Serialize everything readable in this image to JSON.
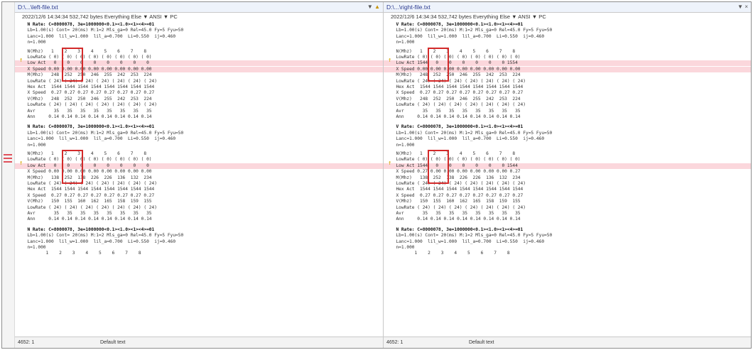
{
  "left": {
    "path": "D:\\...\\left-file.txt",
    "info": "2022/12/6 14:34:34  532,742 bytes  Everything Else ▼  ANSI ▼  PC",
    "status_pos": "4652: 1",
    "status_enc": "Default text"
  },
  "right": {
    "path": "D:\\...\\right-file.txt",
    "info": "2022/12/6 14:34:34  532,742 bytes  Everything Else ▼  ANSI ▼  PC",
    "status_pos": "4652: 1",
    "status_enc": "Default text"
  },
  "toolbar": {
    "nav_up": "▲",
    "nav_dn": "▼",
    "close": "×"
  },
  "block1": {
    "header_l": "  N Rate: C=8000078, 3e=1000000<0.1><1.0><1><4>=01",
    "header_r": "  V Rate: C=8000078, 3e=1000000<0.1><1.0><1><4>=01",
    "rows": [
      {
        "h": false,
        "l": "  N(Mhz)   1    2    3    4    5    6    7    8",
        "r": "  N(Mhz)   1    2    3    4    5    6    7    8"
      },
      {
        "h": false,
        "l": "  LowRate ( 0) ( 0) ( 0) ( 0) ( 0) ( 0) ( 0) ( 0)",
        "r": "  LowRate ( 0) ( 0) ( 0) ( 0) ( 0) ( 0) ( 0) ( 0)"
      },
      {
        "h": true,
        "l": "  Low Act   0    0    0    0    0    0    0    0",
        "r": "  Low Act 1544   0    0    0    0    0    0 1554"
      },
      {
        "h": true,
        "l": "  X Speed 0.00 0.00 0.00 0.00 0.00 0.00 0.00 0.00",
        "r": "  X Speed 0.00 0.00 0.00 0.00 0.00 0.00 0.00 0.00"
      },
      {
        "h": false,
        "l": "  M(Mhz)   248  252  250  246  255  242  253  224",
        "r": "  M(Mhz)   248  252  250  246  255  242  253  224"
      },
      {
        "h": false,
        "l": "  LowRate ( 24) ( 24) ( 24) ( 24) ( 24) ( 24) ( 24)",
        "r": "  LowRate ( 24) ( 24) ( 24) ( 24) ( 24) ( 24) ( 24)"
      },
      {
        "h": false,
        "l": "  Hex Act  1544 1544 1544 1544 1544 1544 1544 1544",
        "r": "  Hex Act  1544 1544 1544 1544 1544 1544 1544 1544"
      },
      {
        "h": false,
        "l": "  X Speed  0.27 0.27 0.27 0.27 0.27 0.27 0.27 0.27",
        "r": "  X Speed  0.27 0.27 0.27 0.27 0.27 0.27 0.27 0.27"
      },
      {
        "h": false,
        "l": "  V(Mhz)   248  252  250  246  255  242  253  224",
        "r": "  V(Mhz)   248  252  250  246  255  242  253  224"
      },
      {
        "h": false,
        "l": "  LowRate ( 24) ( 24) ( 24) ( 24) ( 24) ( 24) ( 24)",
        "r": "  LowRate ( 24) ( 24) ( 24) ( 24) ( 24) ( 24) ( 24)"
      },
      {
        "h": false,
        "l": "  Avr       35   35   35   35   35   35   35   35",
        "r": "  Avr       35   35   35   35   35   35   35   35"
      },
      {
        "h": false,
        "l": "  Ann     0.14 0.14 0.14 0.14 0.14 0.14 0.14 0.14",
        "r": "  Ann     0.14 0.14 0.14 0.14 0.14 0.14 0.14 0.14"
      }
    ]
  },
  "block2": {
    "header_l": "  N Rate: C=8000078, 3e=1000000<0.1><1.0><1><4>=01",
    "header_r": "  V Rate: C=8000078, 3e=1000000<0.1><1.0><1><4>=01",
    "rows": [
      {
        "h": false,
        "l": "  N(Mhz)   1    2    3    4    5    6    7    8",
        "r": "  N(Mhz)   1    2    3    4    5    6    7    8"
      },
      {
        "h": false,
        "l": "  LowRate ( 0) ( 0) ( 0) ( 0) ( 0) ( 0) ( 0) ( 0)",
        "r": "  LowRate ( 0) ( 0) ( 0) ( 0) ( 0) ( 0) ( 0) ( 0)"
      },
      {
        "h": true,
        "l": "  Low Act   0    0    0    0    0    0    0    0",
        "r": "  Low Act 1544   0    0    0    0    0    0 1544"
      },
      {
        "h": false,
        "l": "  X Speed 0.00 0.00 0.00 0.00 0.00 0.00 0.00 0.00",
        "r": "  X Speed 0.27 0.00 0.00 0.00 0.00 0.00 0.00 0.27"
      },
      {
        "h": false,
        "l": "  M(Mhz)   138  252  138  226  226  136  132  234",
        "r": "  M(Mhz)   138  252  138  226  226  136  132  234"
      },
      {
        "h": false,
        "l": "  LowRate ( 24) ( 24) ( 24) ( 24) ( 24) ( 24) ( 24)",
        "r": "  LowRate ( 24) ( 24) ( 24) ( 24) ( 24) ( 24) ( 24)"
      },
      {
        "h": false,
        "l": "  Hex Act  1544 1544 1544 1544 1544 1544 1544 1544",
        "r": "  Hex Act  1544 1544 1544 1544 1544 1544 1544 1544"
      },
      {
        "h": false,
        "l": "  X Speed  0.27 0.27 0.27 0.27 0.27 0.27 0.27 0.27",
        "r": "  X Speed  0.27 0.27 0.27 0.27 0.27 0.27 0.27 0.27"
      },
      {
        "h": false,
        "l": "  V(Mhz)   150  155  160  162  165  158  159  155",
        "r": "  V(Mhz)   150  155  160  162  165  158  159  155"
      },
      {
        "h": false,
        "l": "  LowRate ( 24) ( 24) ( 24) ( 24) ( 24) ( 24) ( 24)",
        "r": "  LowRate ( 24) ( 24) ( 24) ( 24) ( 24) ( 24) ( 24)"
      },
      {
        "h": false,
        "l": "  Avr       35   35   35   35   35   35   35   35",
        "r": "  Avr       35   35   35   35   35   35   35   35"
      },
      {
        "h": false,
        "l": "  Ann     0.14 0.14 0.14 0.14 0.14 0.14 0.14 0.14",
        "r": "  Ann     0.14 0.14 0.14 0.14 0.14 0.14 0.14 0.14"
      }
    ]
  },
  "footer_lines": {
    "l1": "  N Rate: C=8000078, 3e=1000000<0.1><1.0><1><4>=01",
    "l2": "  Lb=1.00(s) Cont= 20(ms) M:1=2 Mls_ga=0 Rel=45.0 Fy=5 Fyu=50",
    "l3": "  Lanc=1.000  lil_w=1.000  lil_a=0.700  Li=0.550  ij=0.460",
    "l4": "  n=1.000",
    "l5": "         1    2    3    4    5    6    7    8"
  }
}
